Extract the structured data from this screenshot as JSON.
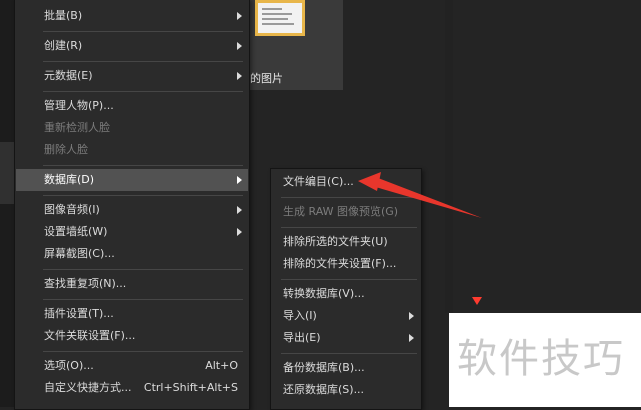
{
  "background": {
    "thumbnail_label": "的图片"
  },
  "main_menu": [
    {
      "label": "批量(B)",
      "submenu": true
    },
    {
      "separator": true
    },
    {
      "label": "创建(R)",
      "submenu": true
    },
    {
      "separator": true
    },
    {
      "label": "元数据(E)",
      "submenu": true
    },
    {
      "separator": true
    },
    {
      "label": "管理人物(P)..."
    },
    {
      "label": "重新检测人脸",
      "disabled": true
    },
    {
      "label": "删除人脸",
      "disabled": true
    },
    {
      "separator": true
    },
    {
      "label": "数据库(D)",
      "submenu": true,
      "highlighted": true
    },
    {
      "separator": true
    },
    {
      "label": "图像音频(I)",
      "submenu": true
    },
    {
      "label": "设置墙纸(W)",
      "submenu": true
    },
    {
      "label": "屏幕截图(C)..."
    },
    {
      "separator": true
    },
    {
      "label": "查找重复项(N)..."
    },
    {
      "separator": true
    },
    {
      "label": "插件设置(T)..."
    },
    {
      "label": "文件关联设置(F)..."
    },
    {
      "separator": true
    },
    {
      "label": "选项(O)...",
      "shortcut": "Alt+O"
    },
    {
      "label": "自定义快捷方式...",
      "shortcut": "Ctrl+Shift+Alt+S"
    }
  ],
  "sub_menu": [
    {
      "label": "文件编目(C)..."
    },
    {
      "separator": true
    },
    {
      "label": "生成 RAW 图像预览(G)",
      "disabled": true
    },
    {
      "separator": true
    },
    {
      "label": "排除所选的文件夹(U)"
    },
    {
      "label": "排除的文件夹设置(F)..."
    },
    {
      "separator": true
    },
    {
      "label": "转换数据库(V)..."
    },
    {
      "label": "导入(I)",
      "submenu": true
    },
    {
      "label": "导出(E)",
      "submenu": true
    },
    {
      "separator": true
    },
    {
      "label": "备份数据库(B)..."
    },
    {
      "label": "还原数据库(S)..."
    }
  ],
  "watermark": {
    "text": "软件技巧"
  },
  "colors": {
    "accent_arrow": "#e8362c",
    "marker": "#ff3b2f",
    "highlight": "#525252"
  }
}
